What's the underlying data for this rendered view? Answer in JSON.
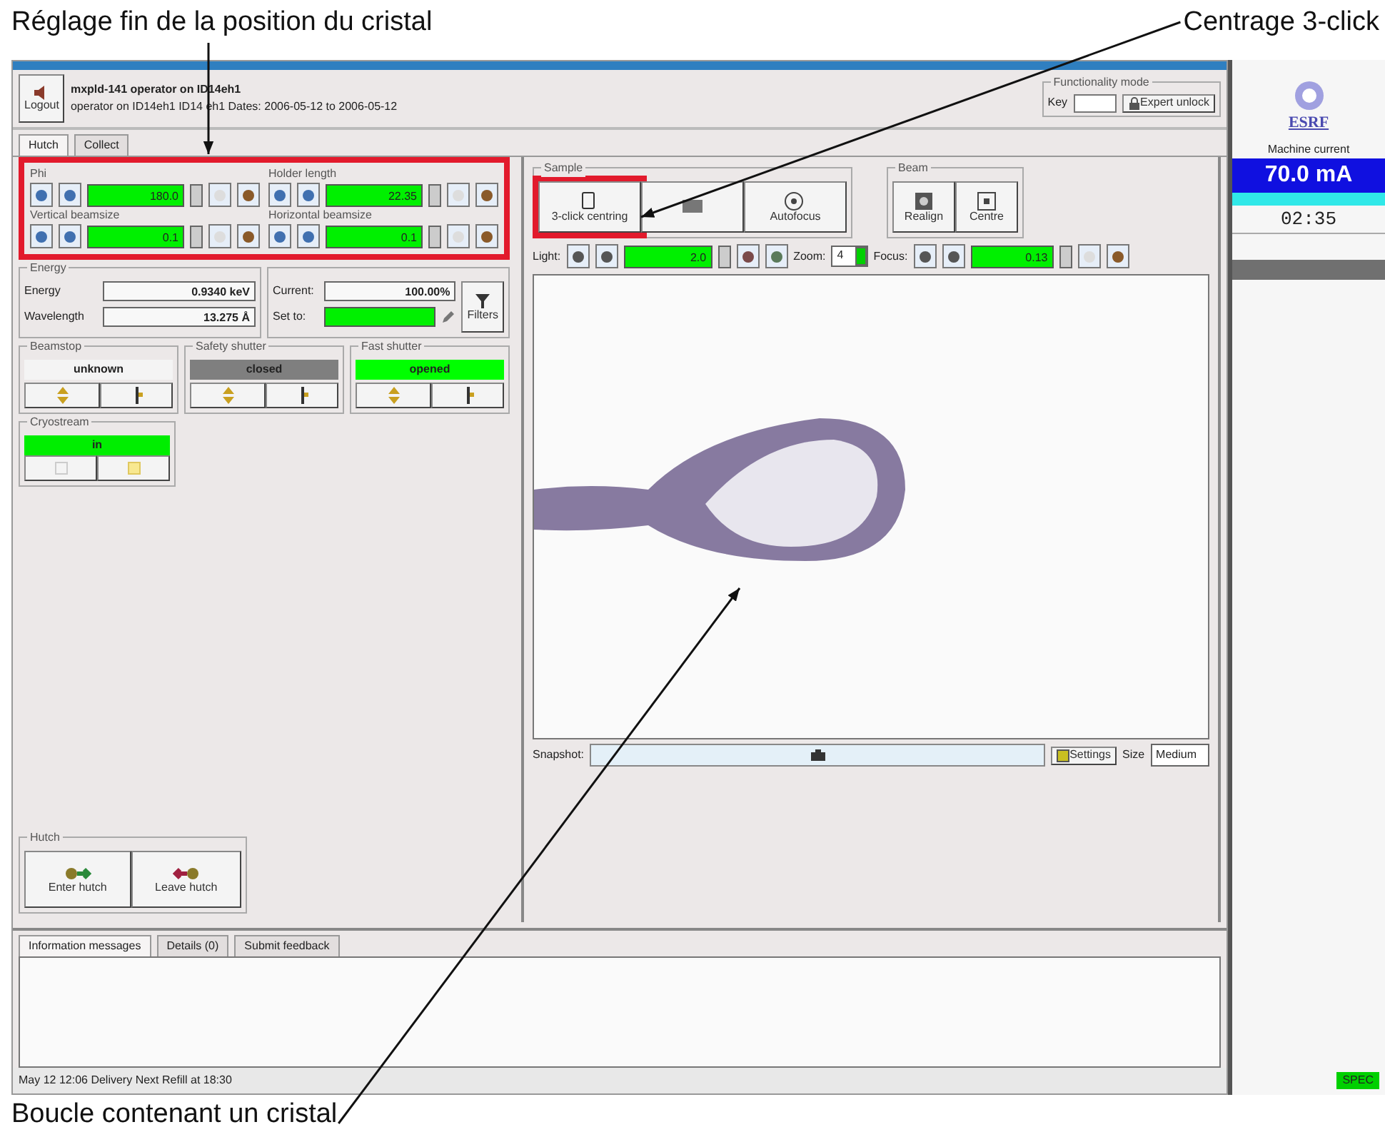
{
  "annotations": [
    {
      "kind": "top-left",
      "text": "Réglage fin de la position du cristal"
    },
    {
      "kind": "top-right",
      "text": "Centrage 3-click"
    },
    {
      "kind": "bottom",
      "text": "Boucle contenant un cristal"
    }
  ],
  "header": {
    "logout": "Logout",
    "user": "mxpld-141 operator on ID14eh1",
    "session": "operator on ID14eh1 ID14 eh1 Dates: 2006-05-12 to 2006-05-12",
    "mode_title": "Functionality mode",
    "key_label": "Key",
    "unlock": "Expert unlock"
  },
  "tabs": [
    {
      "label": "Hutch",
      "selected": true
    },
    {
      "label": "Collect",
      "selected": false
    }
  ],
  "motors": [
    {
      "label": "Phi",
      "value": "180.0"
    },
    {
      "label": "Holder length",
      "value": "22.35"
    },
    {
      "label": "Vertical beamsize",
      "value": "0.1"
    },
    {
      "label": "Horizontal beamsize",
      "value": "0.1"
    }
  ],
  "energy": {
    "title": "Energy",
    "rows": [
      {
        "label": "Energy",
        "value": "0.9340 keV"
      },
      {
        "label": "Wavelength",
        "value": "13.275 Å"
      }
    ]
  },
  "transmission": {
    "current_label": "Current:",
    "current": "100.00%",
    "set_label": "Set to:",
    "filters": "Filters"
  },
  "shutters": [
    {
      "title": "Beamstop",
      "state": "unknown",
      "color": "#f4f4f4"
    },
    {
      "title": "Safety shutter",
      "state": "closed",
      "color": "#7f7f7f"
    },
    {
      "title": "Fast shutter",
      "state": "opened",
      "color": "#00ff00"
    }
  ],
  "cryostream": {
    "title": "Cryostream",
    "state": "in",
    "color": "#00ee00"
  },
  "hutch": {
    "title": "Hutch",
    "buttons": [
      {
        "kind": "enter",
        "label": "Enter hutch"
      },
      {
        "kind": "leave",
        "label": "Leave hutch"
      }
    ]
  },
  "sample": {
    "title": "Sample",
    "buttons": [
      {
        "kind": "centring",
        "label": "3-click centring",
        "highlighted": true
      },
      {
        "kind": "grid",
        "highlighted": false
      },
      {
        "kind": "autofocus",
        "label": "Autofocus",
        "highlighted": false
      }
    ]
  },
  "beam": {
    "title": "Beam",
    "buttons": [
      {
        "kind": "realign",
        "label": "Realign"
      },
      {
        "kind": "centre",
        "label": "Centre"
      }
    ]
  },
  "camera_controls": {
    "light_label": "Light:",
    "light": "2.0",
    "zoom_label": "Zoom:",
    "zoom": "4",
    "focus_label": "Focus:",
    "focus": "0.13"
  },
  "snapshot": {
    "label": "Snapshot:",
    "settings": "Settings",
    "size_label": "Size",
    "size": "Medium"
  },
  "message_tabs": [
    {
      "label": "Information messages",
      "selected": true
    },
    {
      "label": "Details (0)",
      "selected": false
    },
    {
      "label": "Submit feedback",
      "selected": false
    }
  ],
  "status_bar": {
    "text": "May 12 12:06 Delivery Next Refill at 18:30",
    "spec": "SPEC"
  },
  "machine": {
    "logo": "ESRF",
    "title": "Machine current",
    "current": "70.0 mA",
    "countdown": "02:35"
  }
}
